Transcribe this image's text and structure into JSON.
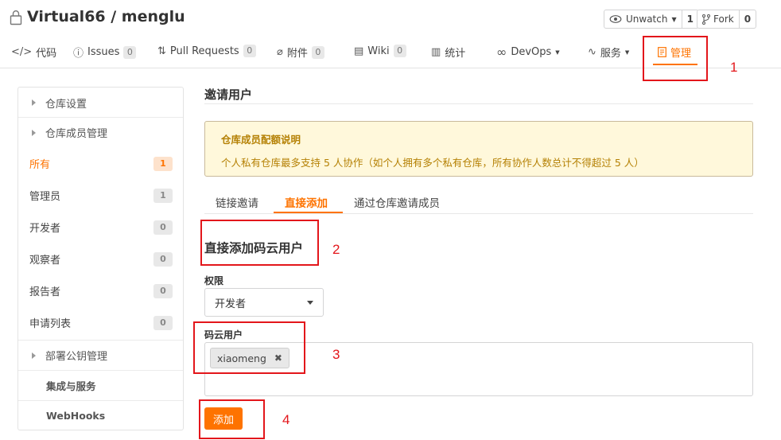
{
  "header": {
    "repo_title": "Virtual66 / menglu",
    "watch_label": "Unwatch",
    "watch_count": "1",
    "fork_label": "Fork",
    "fork_count": "0"
  },
  "tabs": [
    {
      "label": "代码",
      "icon": "code-icon"
    },
    {
      "label": "Issues",
      "badge": "0",
      "icon": "issue-icon"
    },
    {
      "label": "Pull Requests",
      "badge": "0",
      "icon": "pull-request-icon"
    },
    {
      "label": "附件",
      "badge": "0",
      "icon": "paperclip-icon"
    },
    {
      "label": "Wiki",
      "badge": "0",
      "icon": "book-icon"
    },
    {
      "label": "统计",
      "icon": "bar-chart-icon"
    },
    {
      "label": "DevOps",
      "icon": "infinity-icon"
    },
    {
      "label": "服务",
      "icon": "pulse-icon"
    },
    {
      "label": "管理",
      "icon": "settings-doc-icon",
      "active": true
    }
  ],
  "sidebar": {
    "repo_settings": "仓库设置",
    "member_mgmt": "仓库成员管理",
    "members": [
      {
        "label": "所有",
        "count": "1",
        "active": true
      },
      {
        "label": "管理员",
        "count": "1"
      },
      {
        "label": "开发者",
        "count": "0"
      },
      {
        "label": "观察者",
        "count": "0"
      },
      {
        "label": "报告者",
        "count": "0"
      },
      {
        "label": "申请列表",
        "count": "0"
      }
    ],
    "deploy_keys": "部署公钥管理",
    "integrations": "集成与服务",
    "webhooks": "WebHooks"
  },
  "main": {
    "section_title": "邀请用户",
    "notice_title": "仓库成员配额说明",
    "notice_text": "个人私有仓库最多支持 5 人协作（如个人拥有多个私有仓库，所有协作人数总计不得超过 5 人）",
    "subtabs": [
      "链接邀请",
      "直接添加",
      "通过仓库邀请成员"
    ],
    "form_title": "直接添加码云用户",
    "permission_label": "权限",
    "permission_value": "开发者",
    "user_label": "码云用户",
    "user_chip": "xiaomeng",
    "add_button": "添加"
  },
  "annotations": [
    "1",
    "2",
    "3",
    "4"
  ],
  "colors": {
    "accent": "#fe7300",
    "annotation": "#e3161b",
    "notice_bg": "#fff8db",
    "notice_text": "#b58105"
  }
}
